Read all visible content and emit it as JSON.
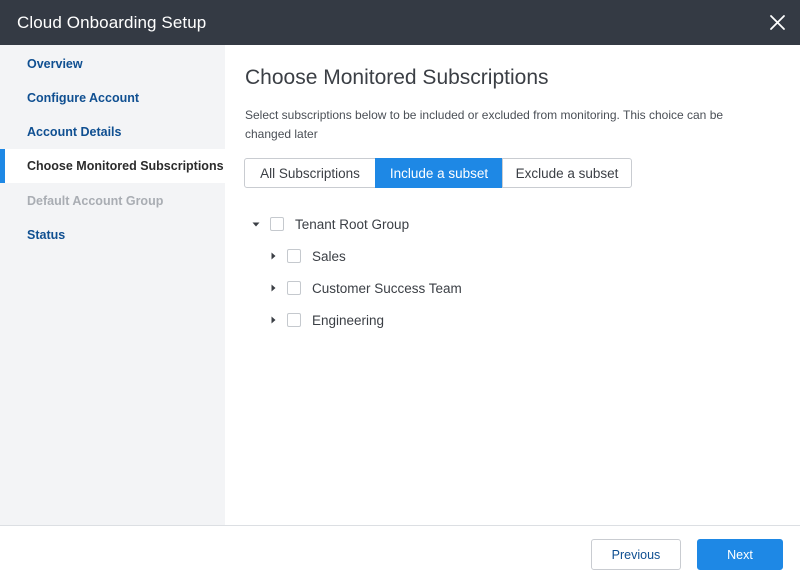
{
  "window": {
    "title": "Cloud Onboarding Setup"
  },
  "sidebar": {
    "items": [
      {
        "label": "Overview",
        "state": "normal"
      },
      {
        "label": "Configure Account",
        "state": "normal"
      },
      {
        "label": "Account Details",
        "state": "normal"
      },
      {
        "label": "Choose Monitored Subscriptions",
        "state": "active"
      },
      {
        "label": "Default Account Group",
        "state": "disabled"
      },
      {
        "label": "Status",
        "state": "normal"
      }
    ]
  },
  "main": {
    "heading": "Choose Monitored Subscriptions",
    "description": "Select subscriptions below to be included or excluded from monitoring. This choice can be changed later",
    "scope_options": [
      {
        "label": "All Subscriptions",
        "selected": false
      },
      {
        "label": "Include a subset",
        "selected": true
      },
      {
        "label": "Exclude a subset",
        "selected": false
      }
    ],
    "tree": {
      "root": {
        "label": "Tenant Root Group",
        "expanded": true,
        "checked": false
      },
      "children": [
        {
          "label": "Sales",
          "expanded": false,
          "checked": false
        },
        {
          "label": "Customer Success Team",
          "expanded": false,
          "checked": false
        },
        {
          "label": "Engineering",
          "expanded": false,
          "checked": false
        }
      ]
    }
  },
  "footer": {
    "previous_label": "Previous",
    "next_label": "Next"
  },
  "colors": {
    "titlebar": "#343a44",
    "accent": "#1e88e5",
    "nav_link": "#0f4f91",
    "sidebar_bg": "#f3f4f6",
    "disabled_text": "#a9adb3"
  }
}
